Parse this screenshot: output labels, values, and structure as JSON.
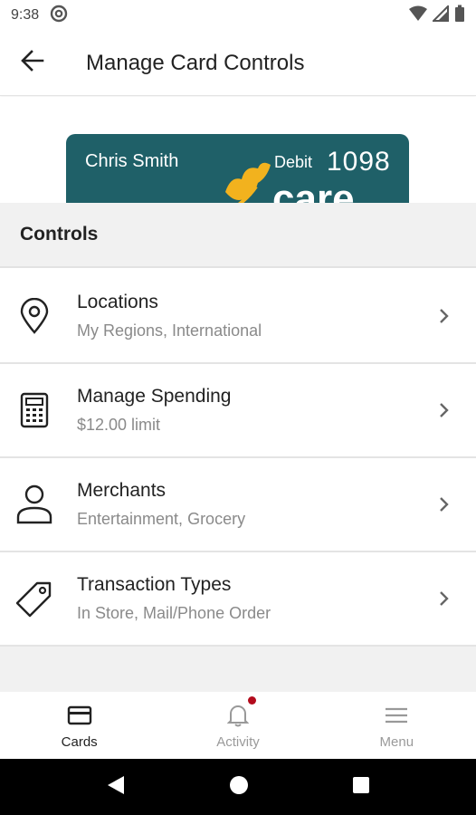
{
  "status_bar": {
    "time": "9:38"
  },
  "app_bar": {
    "title": "Manage Card Controls"
  },
  "card": {
    "holder": "Chris Smith",
    "type": "Debit",
    "last4": "1098",
    "logo_text": "care",
    "color": "#1f6068",
    "logo_color": "#f2b21e"
  },
  "section": {
    "title": "Controls"
  },
  "controls": [
    {
      "title": "Locations",
      "subtitle": "My Regions, International",
      "icon": "location-pin-icon"
    },
    {
      "title": "Manage Spending",
      "subtitle": "$12.00 limit",
      "icon": "calculator-icon"
    },
    {
      "title": "Merchants",
      "subtitle": "Entertainment, Grocery",
      "icon": "person-icon"
    },
    {
      "title": "Transaction Types",
      "subtitle": "In Store, Mail/Phone Order",
      "icon": "tag-icon"
    }
  ],
  "bottom_nav": {
    "items": [
      {
        "label": "Cards",
        "icon": "card-icon",
        "active": true
      },
      {
        "label": "Activity",
        "icon": "bell-icon",
        "active": false
      },
      {
        "label": "Menu",
        "icon": "hamburger-menu-icon",
        "active": false
      }
    ],
    "badge_color": "#b30b1c"
  }
}
